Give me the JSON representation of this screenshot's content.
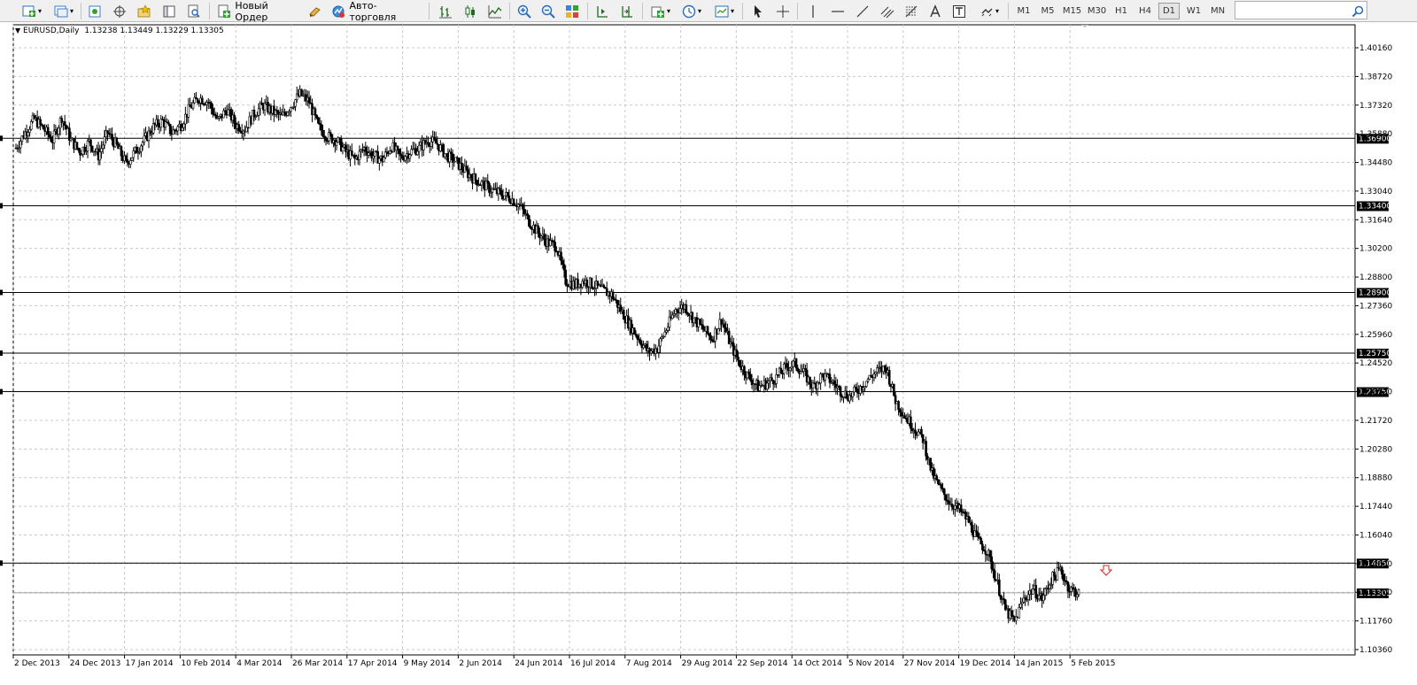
{
  "toolbar": {
    "new_order_label": "Новый Ордер",
    "autotrading_label": "Авто-торговля",
    "timeframes": [
      "M1",
      "M5",
      "M15",
      "M30",
      "H1",
      "H4",
      "D1",
      "W1",
      "MN"
    ],
    "active_timeframe": "D1"
  },
  "chart_header": {
    "symbol_period": "EURUSD,Daily",
    "ohlc": "1.13238 1.13449 1.13229 1.13305"
  },
  "chart_data": {
    "type": "candlestick",
    "ylim": [
      1.1036,
      1.416
    ],
    "price_ticks": [
      "1.40160",
      "1.38720",
      "1.37320",
      "1.35880",
      "1.34480",
      "1.33040",
      "1.31640",
      "1.30200",
      "1.28800",
      "1.27360",
      "1.25960",
      "1.24520",
      "1.23120",
      "1.21720",
      "1.20280",
      "1.18880",
      "1.17440",
      "1.16040",
      "1.14600",
      "1.13200",
      "1.11760",
      "1.10360"
    ],
    "date_ticks": [
      "2 Dec 2013",
      "24 Dec 2013",
      "17 Jan 2014",
      "10 Feb 2014",
      "4 Mar 2014",
      "26 Mar 2014",
      "17 Apr 2014",
      "9 May 2014",
      "2 Jun 2014",
      "24 Jun 2014",
      "16 Jul 2014",
      "7 Aug 2014",
      "29 Aug 2014",
      "22 Sep 2014",
      "14 Oct 2014",
      "5 Nov 2014",
      "27 Nov 2014",
      "19 Dec 2014",
      "14 Jan 2015",
      "5 Feb 2015"
    ],
    "horizontal_levels": [
      {
        "price": 1.369,
        "label": "1.36900"
      },
      {
        "price": 1.334,
        "label": "1.33400"
      },
      {
        "price": 1.289,
        "label": "1.28900"
      },
      {
        "price": 1.2575,
        "label": "1.25750"
      },
      {
        "price": 1.2375,
        "label": "1.23750"
      },
      {
        "price": 1.1485,
        "label": "1.14850"
      }
    ],
    "bid_level": {
      "price": 1.13305,
      "label": "1.13305"
    },
    "path": [
      [
        0,
        1.364
      ],
      [
        6,
        1.372
      ],
      [
        12,
        1.379
      ],
      [
        18,
        1.374
      ],
      [
        24,
        1.368
      ],
      [
        30,
        1.38
      ],
      [
        36,
        1.368
      ],
      [
        42,
        1.362
      ],
      [
        48,
        1.367
      ],
      [
        54,
        1.36
      ],
      [
        60,
        1.372
      ],
      [
        66,
        1.365
      ],
      [
        72,
        1.356
      ],
      [
        78,
        1.362
      ],
      [
        84,
        1.368
      ],
      [
        90,
        1.375
      ],
      [
        96,
        1.378
      ],
      [
        102,
        1.372
      ],
      [
        108,
        1.376
      ],
      [
        114,
        1.385
      ],
      [
        120,
        1.39
      ],
      [
        126,
        1.388
      ],
      [
        132,
        1.378
      ],
      [
        138,
        1.384
      ],
      [
        144,
        1.376
      ],
      [
        150,
        1.374
      ],
      [
        156,
        1.382
      ],
      [
        162,
        1.386
      ],
      [
        168,
        1.383
      ],
      [
        174,
        1.38
      ],
      [
        180,
        1.386
      ],
      [
        186,
        1.392
      ],
      [
        192,
        1.388
      ],
      [
        198,
        1.375
      ],
      [
        204,
        1.37
      ],
      [
        210,
        1.368
      ],
      [
        216,
        1.362
      ],
      [
        222,
        1.358
      ],
      [
        228,
        1.364
      ],
      [
        234,
        1.36
      ],
      [
        240,
        1.358
      ],
      [
        246,
        1.365
      ],
      [
        252,
        1.359
      ],
      [
        258,
        1.362
      ],
      [
        264,
        1.364
      ],
      [
        270,
        1.368
      ],
      [
        276,
        1.366
      ],
      [
        282,
        1.36
      ],
      [
        288,
        1.357
      ],
      [
        294,
        1.352
      ],
      [
        300,
        1.348
      ],
      [
        306,
        1.345
      ],
      [
        312,
        1.342
      ],
      [
        318,
        1.34
      ],
      [
        324,
        1.338
      ],
      [
        330,
        1.334
      ],
      [
        336,
        1.326
      ],
      [
        342,
        1.32
      ],
      [
        348,
        1.315
      ],
      [
        354,
        1.313
      ],
      [
        360,
        1.295
      ],
      [
        366,
        1.293
      ],
      [
        372,
        1.295
      ],
      [
        378,
        1.293
      ],
      [
        384,
        1.29
      ],
      [
        390,
        1.288
      ],
      [
        396,
        1.28
      ],
      [
        402,
        1.272
      ],
      [
        408,
        1.265
      ],
      [
        414,
        1.258
      ],
      [
        420,
        1.26
      ],
      [
        426,
        1.27
      ],
      [
        432,
        1.28
      ],
      [
        438,
        1.282
      ],
      [
        444,
        1.275
      ],
      [
        450,
        1.27
      ],
      [
        456,
        1.265
      ],
      [
        462,
        1.275
      ],
      [
        468,
        1.262
      ],
      [
        474,
        1.252
      ],
      [
        480,
        1.245
      ],
      [
        486,
        1.24
      ],
      [
        492,
        1.242
      ],
      [
        498,
        1.245
      ],
      [
        504,
        1.25
      ],
      [
        510,
        1.252
      ],
      [
        516,
        1.247
      ],
      [
        522,
        1.24
      ],
      [
        528,
        1.246
      ],
      [
        534,
        1.243
      ],
      [
        540,
        1.238
      ],
      [
        546,
        1.235
      ],
      [
        552,
        1.239
      ],
      [
        558,
        1.244
      ],
      [
        564,
        1.248
      ],
      [
        570,
        1.25
      ],
      [
        576,
        1.233
      ],
      [
        582,
        1.225
      ],
      [
        588,
        1.219
      ],
      [
        594,
        1.213
      ],
      [
        600,
        1.195
      ],
      [
        606,
        1.186
      ],
      [
        612,
        1.18
      ],
      [
        618,
        1.176
      ],
      [
        624,
        1.17
      ],
      [
        630,
        1.16
      ],
      [
        636,
        1.155
      ],
      [
        642,
        1.14
      ],
      [
        648,
        1.124
      ],
      [
        654,
        1.118
      ],
      [
        660,
        1.13
      ],
      [
        666,
        1.135
      ],
      [
        672,
        1.13
      ],
      [
        678,
        1.14
      ],
      [
        684,
        1.145
      ],
      [
        690,
        1.135
      ],
      [
        696,
        1.133
      ]
    ]
  }
}
